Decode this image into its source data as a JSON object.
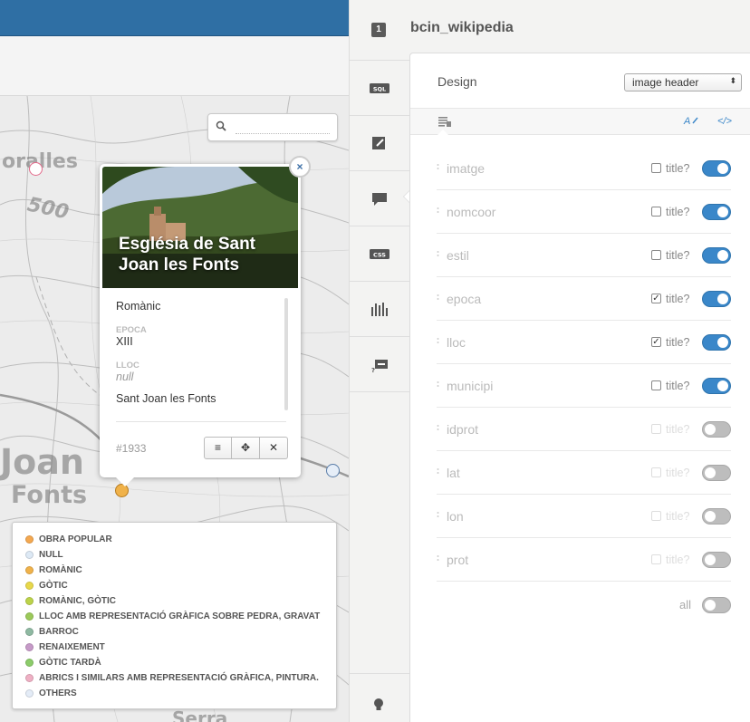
{
  "map": {
    "search_placeholder": "",
    "labels": [
      "oralles",
      "500",
      "Joan",
      "Fonts",
      "Serra"
    ]
  },
  "popup": {
    "title": "Església de Sant Joan les Fonts",
    "first_value": "Romànic",
    "fields": [
      {
        "label": "EPOCA",
        "value": "XIII"
      },
      {
        "label": "LLOC",
        "value": "null"
      }
    ],
    "last_value": "Sant Joan les Fonts",
    "id": "#1933",
    "close_label": "×",
    "buttons": {
      "list": "≡",
      "move": "✥",
      "remove": "✕"
    }
  },
  "legend": {
    "items": [
      {
        "label": "OBRA POPULAR",
        "color": "#f4a850"
      },
      {
        "label": "NULL",
        "color": "#dde9f5"
      },
      {
        "label": "ROMÀNIC",
        "color": "#f0b24a"
      },
      {
        "label": "GÒTIC",
        "color": "#e8d84a"
      },
      {
        "label": "ROMÀNIC, GÒTIC",
        "color": "#bcd34a"
      },
      {
        "label": "LLOC AMB REPRESENTACIÓ GRÀFICA SOBRE PEDRA, GRAVAT",
        "color": "#9cca5a"
      },
      {
        "label": "BARROC",
        "color": "#8fb9a2"
      },
      {
        "label": "RENAIXEMENT",
        "color": "#c69ac8"
      },
      {
        "label": "GÒTIC TARDÀ",
        "color": "#8ccc6a"
      },
      {
        "label": "ABRICS I SIMILARS AMB REPRESENTACIÓ GRÀFICA, PINTURA.",
        "color": "#efb0c4"
      },
      {
        "label": "OTHERS",
        "color": "#e4ecf7"
      }
    ]
  },
  "panel": {
    "layer_number": "1",
    "layer_name": "bcin_wikipedia",
    "design_label": "Design",
    "template_value": "image header",
    "select_arrow": "⬍",
    "link_wizard": "A",
    "link_code": "</>",
    "title_label": "title?",
    "all_label": "all",
    "fields": [
      {
        "name": "imatge",
        "title": false,
        "visible": true
      },
      {
        "name": "nomcoor",
        "title": false,
        "visible": true
      },
      {
        "name": "estil",
        "title": false,
        "visible": true
      },
      {
        "name": "epoca",
        "title": true,
        "visible": true
      },
      {
        "name": "lloc",
        "title": true,
        "visible": true
      },
      {
        "name": "municipi",
        "title": false,
        "visible": true
      },
      {
        "name": "idprot",
        "title": false,
        "visible": false
      },
      {
        "name": "lat",
        "title": false,
        "visible": false
      },
      {
        "name": "lon",
        "title": false,
        "visible": false
      },
      {
        "name": "prot",
        "title": false,
        "visible": false
      }
    ],
    "tools": [
      "sql-icon",
      "wizard-icon",
      "infowindow-icon",
      "css-icon",
      "legend-icon",
      "tooltip-icon"
    ],
    "accent": "#3a87c9"
  }
}
